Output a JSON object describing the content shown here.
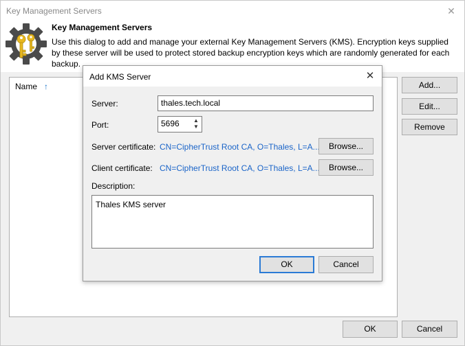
{
  "window": {
    "title": "Key Management Servers",
    "close_glyph": "✕"
  },
  "header": {
    "title": "Key Management Servers",
    "description": "Use this dialog to add and manage your external Key Management Servers (KMS). Encryption keys supplied by these server will be used to protect stored backup encryption keys which are randomly generated for each backup.",
    "icon": "gear-key-icon"
  },
  "list": {
    "column_name": "Name",
    "sort_icon": "↑"
  },
  "side_buttons": {
    "add": "Add...",
    "edit": "Edit...",
    "remove": "Remove"
  },
  "footer": {
    "ok": "OK",
    "cancel": "Cancel"
  },
  "dialog": {
    "title": "Add KMS Server",
    "close_glyph": "✕",
    "server_label": "Server:",
    "server_value": "thales.tech.local",
    "port_label": "Port:",
    "port_value": "5696",
    "server_cert_label": "Server certificate:",
    "server_cert_value": "CN=CipherTrust Root CA, O=Thales, L=A...",
    "client_cert_label": "Client certificate:",
    "client_cert_value": "CN=CipherTrust Root CA, O=Thales, L=A...",
    "browse": "Browse...",
    "description_label": "Description:",
    "description_value": "Thales KMS server",
    "ok": "OK",
    "cancel": "Cancel"
  },
  "colors": {
    "accent": "#2a7ad5",
    "link": "#1a64c8",
    "gear": "#4a4a4a",
    "key": "#e8b820"
  }
}
